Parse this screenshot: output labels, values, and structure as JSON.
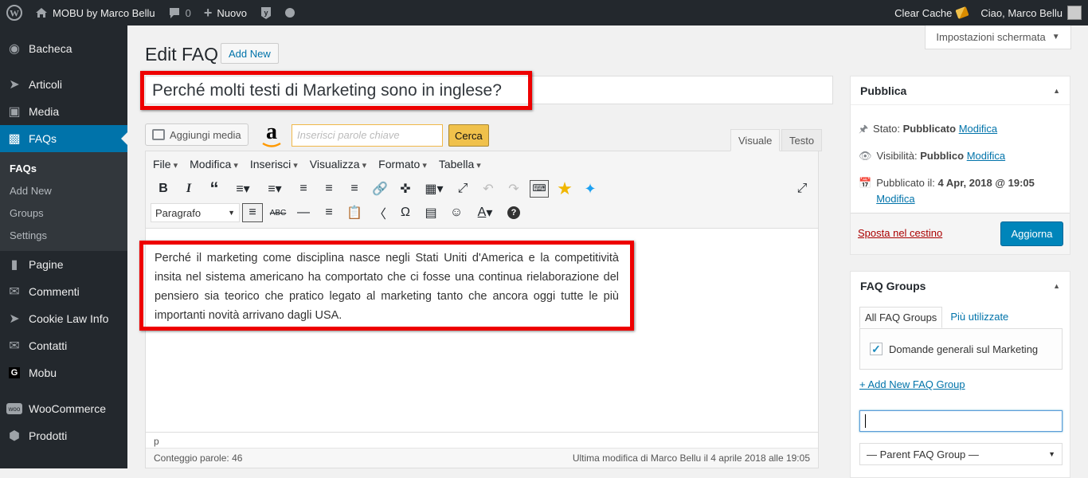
{
  "adminbar": {
    "site_name": "MOBU by Marco Bellu",
    "comments_count": "0",
    "new_label": "Nuovo",
    "clear_cache": "Clear Cache",
    "greeting": "Ciao, Marco Bellu"
  },
  "sidebar": {
    "items": [
      {
        "label": "Bacheca",
        "icon": "dashboard-icon"
      },
      {
        "label": "Articoli",
        "icon": "pin-icon"
      },
      {
        "label": "Media",
        "icon": "media-icon"
      },
      {
        "label": "FAQs",
        "icon": "faq-icon"
      },
      {
        "label": "Pagine",
        "icon": "page-icon"
      },
      {
        "label": "Commenti",
        "icon": "comment-icon"
      },
      {
        "label": "Cookie Law Info",
        "icon": "pin-icon"
      },
      {
        "label": "Contatti",
        "icon": "mail-icon"
      },
      {
        "label": "Mobu",
        "icon": "mobu-icon"
      },
      {
        "label": "WooCommerce",
        "icon": "woo-icon"
      },
      {
        "label": "Prodotti",
        "icon": "box-icon"
      }
    ],
    "submenu": [
      "FAQs",
      "Add New",
      "Groups",
      "Settings"
    ]
  },
  "screen_options": "Impostazioni schermata",
  "page": {
    "title": "Edit FAQ",
    "add_new": "Add New",
    "post_title": "Perché molti testi di Marketing sono in inglese?"
  },
  "editor": {
    "add_media": "Aggiungi media",
    "keyword_placeholder": "Inserisci parole chiave",
    "search_button": "Cerca",
    "tab_visual": "Visuale",
    "tab_text": "Testo",
    "menus": [
      "File",
      "Modifica",
      "Inserisci",
      "Visualizza",
      "Formato",
      "Tabella"
    ],
    "format_select": "Paragrafo",
    "content": "Perché il marketing come disciplina nasce negli Stati Uniti d'America e la competitività insita nel sistema americano ha comportato che ci fosse una continua rielaborazione del pensiero sia teorico che pratico legato al marketing tanto che ancora oggi tutte le più importanti novità arrivano dagli USA.",
    "path": "p",
    "word_count": "Conteggio parole: 46",
    "last_modified": "Ultima modifica di Marco Bellu il 4 aprile 2018 alle 19:05"
  },
  "publish": {
    "title": "Pubblica",
    "status_label": "Stato:",
    "status_value": "Pubblicato",
    "visibility_label": "Visibilità:",
    "visibility_value": "Pubblico",
    "published_label": "Pubblicato il:",
    "published_value": "4 Apr, 2018 @ 19:05",
    "edit_link": "Modifica",
    "trash": "Sposta nel cestino",
    "update": "Aggiorna"
  },
  "faq_groups": {
    "title": "FAQ Groups",
    "tab_all": "All FAQ Groups",
    "tab_popular": "Più utilizzate",
    "group_item": "Domande generali sul Marketing",
    "add_new": "+ Add New FAQ Group",
    "parent_select": "— Parent FAQ Group —"
  },
  "colors": {
    "accent": "#0073aa",
    "highlight": "#e00000",
    "adminbar": "#23282d"
  }
}
